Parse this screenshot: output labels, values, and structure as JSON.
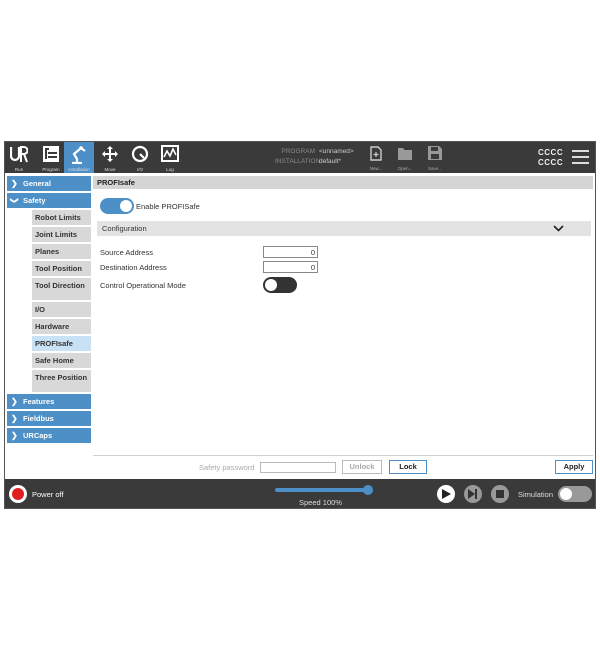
{
  "topbar": {
    "nav_buttons": [
      {
        "label": "Run"
      },
      {
        "label": "Program"
      },
      {
        "label": "Installation"
      },
      {
        "label": "Move"
      },
      {
        "label": "I/O"
      },
      {
        "label": "Log"
      }
    ],
    "program_key": "PROGRAM",
    "program_value": "<unnamed>",
    "installation_key": "INSTALLATION",
    "installation_value": "default*",
    "file_buttons": [
      {
        "label": "New..."
      },
      {
        "label": "Open..."
      },
      {
        "label": "Save..."
      }
    ],
    "status_line1": "CCCC",
    "status_line2": "CCCC",
    "accent": "#4d8fc7"
  },
  "sidebar": {
    "general": "General",
    "safety": "Safety",
    "safety_items": [
      {
        "label": "Robot Limits"
      },
      {
        "label": "Joint Limits"
      },
      {
        "label": "Planes"
      },
      {
        "label": "Tool Position"
      },
      {
        "label": "Tool Direction"
      },
      {
        "label": "I/O"
      },
      {
        "label": "Hardware"
      },
      {
        "label": "PROFIsafe"
      },
      {
        "label": "Safe Home"
      },
      {
        "label": "Three Position"
      }
    ],
    "selected": "PROFIsafe",
    "features": "Features",
    "fieldbus": "Fieldbus",
    "urcaps": "URCaps"
  },
  "panel": {
    "title": "PROFIsafe",
    "enable_label": "Enable PROFISafe",
    "enable_on": true,
    "configuration_label": "Configuration",
    "source_address_label": "Source Address",
    "source_address_value": "0",
    "destination_address_label": "Destination Address",
    "destination_address_value": "0",
    "control_mode_label": "Control Operational Mode",
    "control_mode_on": false
  },
  "bottom": {
    "password_label": "Safety password",
    "unlock_label": "Unlock",
    "lock_label": "Lock",
    "apply_label": "Apply"
  },
  "footer": {
    "power_label": "Power off",
    "speed_label": "Speed 100%",
    "speed_value": 100,
    "simulation_label": "Simulation",
    "simulation_on": false
  }
}
